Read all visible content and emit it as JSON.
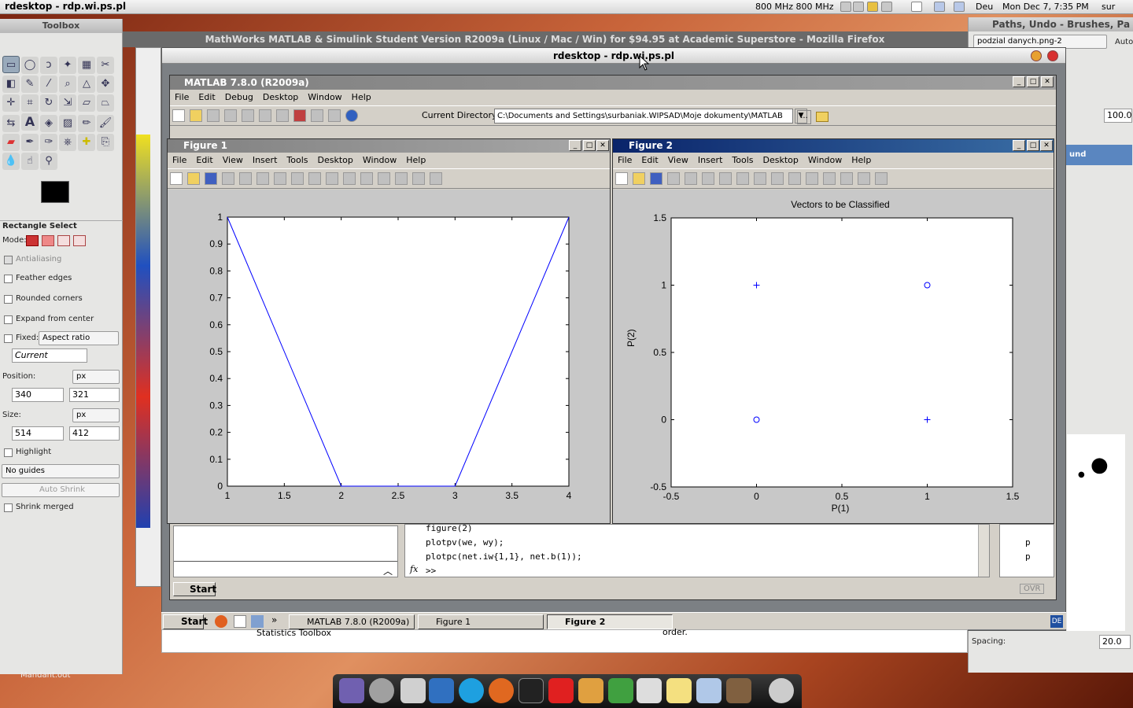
{
  "topbar": {
    "title": "rdesktop - rdp.wi.ps.pl",
    "cpu": "800 MHz 800 MHz",
    "lang": "Deu",
    "datetime": "Mon Dec  7,  7:35 PM",
    "user": "sur"
  },
  "firefox": {
    "title": "MathWorks MATLAB & Simulink Student Version R2009a (Linux / Mac / Win) for $94.95 at Academic Superstore - Mozilla Firefox"
  },
  "rdesktop": {
    "title": "rdesktop - rdp.wi.ps.pl"
  },
  "toolbox": {
    "title": "Toolbox",
    "tool_name": "Rectangle Select",
    "mode_label": "Mode:",
    "antialiasing": "Antialiasing",
    "feather": "Feather edges",
    "rounded": "Rounded corners",
    "expand": "Expand from center",
    "fixed": "Fixed:",
    "fixed_value": "Aspect ratio",
    "current": "Current",
    "position_label": "Position:",
    "unit1": "px",
    "pos_x": "340",
    "pos_y": "321",
    "size_label": "Size:",
    "unit2": "px",
    "size_w": "514",
    "size_h": "412",
    "highlight": "Highlight",
    "guides": "No guides",
    "auto_shrink": "Auto Shrink",
    "shrink_merged": "Shrink merged",
    "file_label": "Mandant.odt"
  },
  "rpanel": {
    "title": "Paths, Undo - Brushes, Pa",
    "file": "podzial danych.png-2",
    "auto": "Auto",
    "zoom": "100.0",
    "und": "und",
    "spacing_label": "Spacing:",
    "spacing": "20.0"
  },
  "matlab": {
    "title": "MATLAB  7.8.0 (R2009a)",
    "menus": [
      "File",
      "Edit",
      "Debug",
      "Desktop",
      "Window",
      "Help"
    ],
    "cur_dir_label": "Current Directory:",
    "cur_dir": "C:\\Documents and Settings\\surbaniak.WIPSAD\\Moje dokumenty\\MATLAB",
    "cmd_lines": [
      "figure(2)",
      "plotpv(we, wy);",
      "plotpc(net.iw{1,1}, net.b(1));",
      ">>"
    ],
    "fx": "fx",
    "start": "Start",
    "ovr": "OVR",
    "hist": [
      "p",
      "p"
    ]
  },
  "figure1": {
    "title": "Figure 1",
    "menus": [
      "File",
      "Edit",
      "View",
      "Insert",
      "Tools",
      "Desktop",
      "Window",
      "Help"
    ],
    "xticks": [
      "1",
      "1.5",
      "2",
      "2.5",
      "3",
      "3.5",
      "4"
    ],
    "yticks": [
      "0",
      "0.1",
      "0.2",
      "0.3",
      "0.4",
      "0.5",
      "0.6",
      "0.7",
      "0.8",
      "0.9",
      "1"
    ]
  },
  "figure2": {
    "title": "Figure 2",
    "menus": [
      "File",
      "Edit",
      "View",
      "Insert",
      "Tools",
      "Desktop",
      "Window",
      "Help"
    ],
    "plot_title": "Vectors to be Classified",
    "xlabel": "P(1)",
    "ylabel": "P(2)",
    "xticks": [
      "-0.5",
      "0",
      "0.5",
      "1",
      "1.5"
    ],
    "yticks": [
      "-0.5",
      "0",
      "0.5",
      "1",
      "1.5"
    ]
  },
  "taskbar": {
    "start": "Start",
    "items": [
      "MATLAB  7.8.0 (R2009a)",
      "Figure 1",
      "Figure 2"
    ],
    "behind1": "Statistics Toolbox",
    "behind2": "order."
  },
  "chart_data": [
    {
      "type": "line",
      "title": "",
      "xlabel": "",
      "ylabel": "",
      "xlim": [
        1,
        4
      ],
      "ylim": [
        0,
        1
      ],
      "x": [
        1,
        2,
        3,
        4
      ],
      "series": [
        {
          "values": [
            1,
            0,
            0,
            1
          ],
          "color": "#0000ff"
        }
      ]
    },
    {
      "type": "scatter",
      "title": "Vectors to be Classified",
      "xlabel": "P(1)",
      "ylabel": "P(2)",
      "xlim": [
        -0.5,
        1.5
      ],
      "ylim": [
        -0.5,
        1.5
      ],
      "points": [
        {
          "x": 0,
          "y": 1,
          "marker": "+"
        },
        {
          "x": 1,
          "y": 0,
          "marker": "+"
        },
        {
          "x": 0,
          "y": 0,
          "marker": "o"
        },
        {
          "x": 1,
          "y": 1,
          "marker": "o"
        }
      ],
      "color": "#0000ff"
    }
  ]
}
